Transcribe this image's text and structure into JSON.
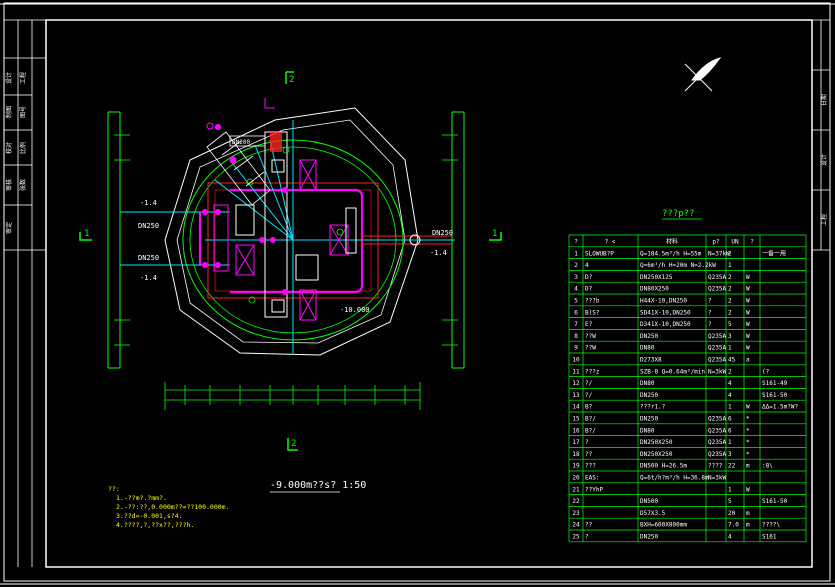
{
  "drawing": {
    "caption": "-9.000m??s? 1:50",
    "section_marks": {
      "s1_label": "1",
      "s2_label": "2"
    },
    "labels": {
      "dn250_left_upper": "DN250",
      "dn250_left_lower": "DN250",
      "dn250_right": "DN250",
      "elev_left_upper": "-1.4",
      "elev_left_lower": "-1.4",
      "elev_right": "-1.4",
      "elev_bottom": "-10.000",
      "dn_top": "DN200"
    },
    "notes": [
      "??:",
      "1.-??m?.?mm?.",
      "2.-??:??,0.000m??=??100.000m.",
      "3.??d=-0.001,s?4.",
      "4.????,?,??x??,???h."
    ]
  },
  "table": {
    "title": "???p??",
    "headers": [
      "?",
      "? <",
      "材料",
      "p?",
      "UN",
      "?"
    ],
    "rows": [
      [
        "1",
        "SLOWUB?P",
        "Q=184.5m³/h H=55m",
        "N=37kW",
        "2",
        "",
        "一备一用"
      ],
      [
        "2",
        "4",
        "Q=6m³/h H=20m N=2.2kW",
        "",
        "1",
        "",
        ""
      ],
      [
        "3",
        "D?",
        "DN250X125",
        "Q235A",
        "2",
        "W",
        ""
      ],
      [
        "4",
        "D?",
        "DN80X250",
        "Q235A",
        "2",
        "W",
        ""
      ],
      [
        "5",
        "???b",
        "H44X-10,DN250",
        "?",
        "2",
        "W",
        ""
      ],
      [
        "6",
        "B)S?",
        "SD41X-10,DN250",
        "?",
        "2",
        "W",
        ""
      ],
      [
        "7",
        "E?",
        "D341X-10,DN250",
        "?",
        "5",
        "W",
        ""
      ],
      [
        "8",
        "??W",
        "DN250",
        "Q235A",
        "3",
        "W",
        ""
      ],
      [
        "9",
        "??W",
        "DN80",
        "Q235A",
        "1",
        "W",
        ""
      ],
      [
        "10",
        "",
        "D273X8",
        "Q235A",
        "45",
        "a",
        ""
      ],
      [
        "11",
        "???z",
        "SZB-8 Q=0.64m³/min",
        "N=3kW",
        "2",
        "",
        "(?"
      ],
      [
        "12",
        "?/",
        "DN80",
        "",
        "4",
        "",
        "S161-49"
      ],
      [
        "13",
        "?/",
        "DN250",
        "",
        "4",
        "",
        "S161-50"
      ],
      [
        "14",
        "B?",
        "???r1.?",
        "",
        "1",
        "W",
        "ΔΔ=1.5m?W?"
      ],
      [
        "15",
        "B?/",
        "DN250",
        "Q235A",
        "6",
        "*",
        ""
      ],
      [
        "16",
        "B?/",
        "DN80",
        "Q235A",
        "6",
        "*",
        ""
      ],
      [
        "17",
        "?",
        "DN250X250",
        "Q235A",
        "1",
        "*",
        ""
      ],
      [
        "18",
        "??",
        "DN250X250",
        "Q235A",
        "3",
        "*",
        ""
      ],
      [
        "19",
        "???",
        "DN500 H=26.5m",
        "????",
        "22",
        "m",
        ":8\\"
      ],
      [
        "20",
        "EAS:",
        "Q=6t/h?m³/h H=36.8m",
        "N=3kW",
        "",
        "",
        ""
      ],
      [
        "21",
        "??YhP",
        "",
        "",
        "1",
        "W",
        ""
      ],
      [
        "22",
        "",
        "DN500",
        "",
        "5",
        "",
        "S161-50"
      ],
      [
        "23",
        "",
        "D57X3.5",
        "",
        "20",
        "m",
        ""
      ],
      [
        "24",
        "??",
        "BXH=600X800mm",
        "",
        "7.0",
        "m",
        "????\\"
      ],
      [
        "25",
        "?",
        "DN250",
        "",
        "4",
        "",
        "S161"
      ]
    ]
  },
  "title_block": {
    "col_a": [
      "设计",
      "制图",
      "校对",
      "审核",
      "审定",
      "日期"
    ],
    "col_b": [
      "工程",
      "图号",
      "比例",
      "张数"
    ]
  },
  "colors": {
    "frame": "#ffffff",
    "green": "#00ff00",
    "cyan": "#00e5ff",
    "red": "#ff2020",
    "magenta": "#ff00ff",
    "yellow": "#ffff00",
    "white": "#ffffff"
  }
}
